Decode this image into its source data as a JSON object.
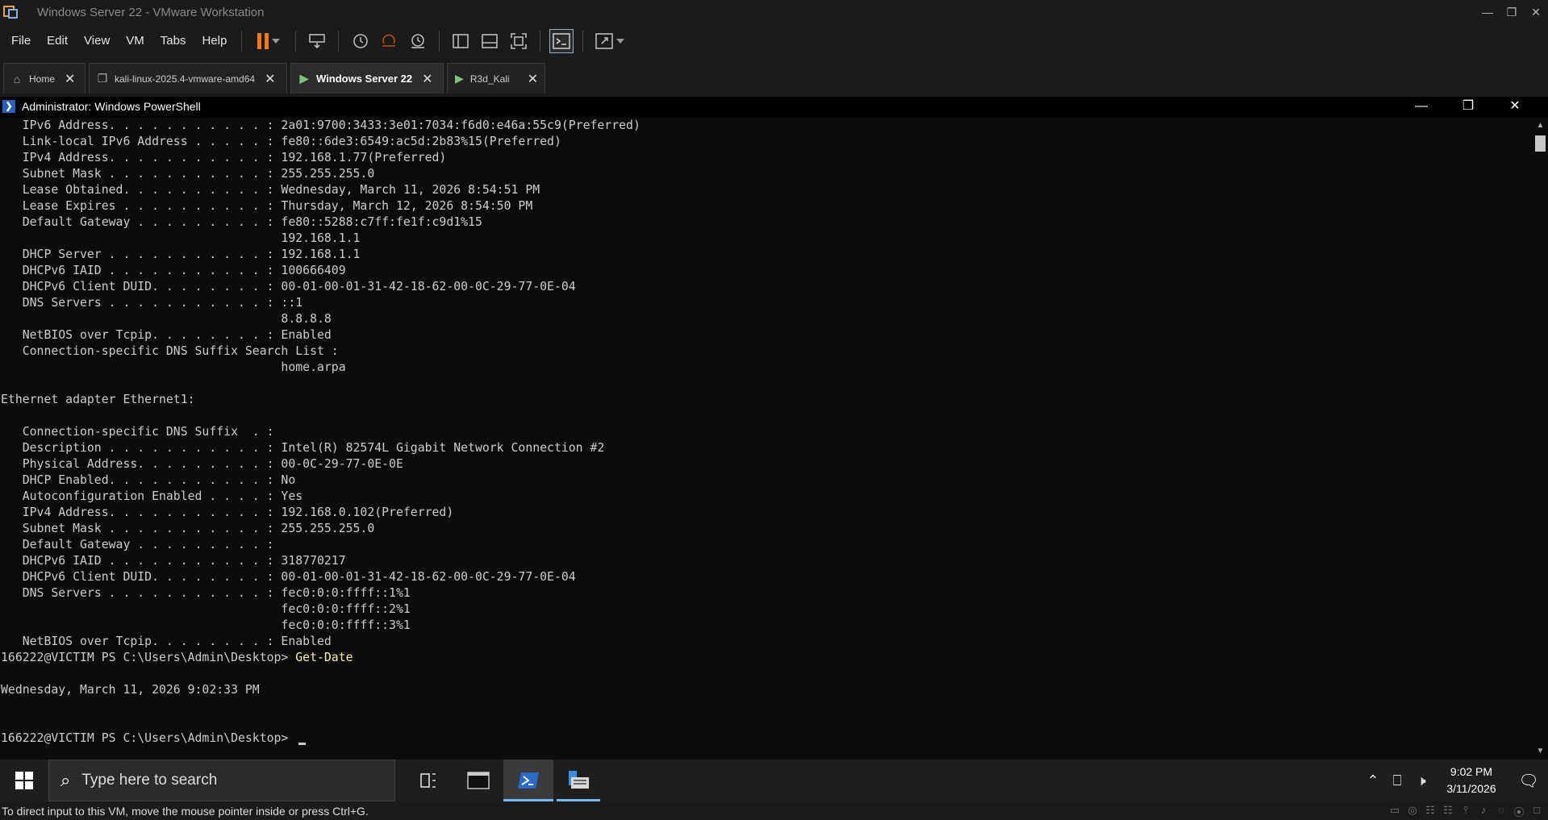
{
  "window": {
    "title": "Windows Server 22 - VMware Workstation"
  },
  "menu": [
    "File",
    "Edit",
    "View",
    "VM",
    "Tabs",
    "Help"
  ],
  "tabs": [
    {
      "label": "Home",
      "icon": "home-icon",
      "active": false
    },
    {
      "label": "kali-linux-2025.4-vmware-amd64",
      "icon": "vm-icon",
      "active": false
    },
    {
      "label": "Windows Server 22",
      "icon": "vm-running-icon",
      "active": true
    },
    {
      "label": "R3d_Kali",
      "icon": "vm-running-icon",
      "active": false
    }
  ],
  "powershell": {
    "title": "Administrator: Windows PowerShell",
    "lines": [
      {
        "text": "   IPv6 Address. . . . . . . . . . . : 2a01:9700:3433:3e01:7034:f6d0:e46a:55c9(Preferred)"
      },
      {
        "text": "   Link-local IPv6 Address . . . . . : fe80::6de3:6549:ac5d:2b83%15(Preferred)"
      },
      {
        "text": "   IPv4 Address. . . . . . . . . . . : 192.168.1.77(Preferred)"
      },
      {
        "text": "   Subnet Mask . . . . . . . . . . . : 255.255.255.0"
      },
      {
        "text": "   Lease Obtained. . . . . . . . . . : Wednesday, March 11, 2026 8:54:51 PM"
      },
      {
        "text": "   Lease Expires . . . . . . . . . . : Thursday, March 12, 2026 8:54:50 PM"
      },
      {
        "text": "   Default Gateway . . . . . . . . . : fe80::5288:c7ff:fe1f:c9d1%15"
      },
      {
        "text": "                                       192.168.1.1"
      },
      {
        "text": "   DHCP Server . . . . . . . . . . . : 192.168.1.1"
      },
      {
        "text": "   DHCPv6 IAID . . . . . . . . . . . : 100666409"
      },
      {
        "text": "   DHCPv6 Client DUID. . . . . . . . : 00-01-00-01-31-42-18-62-00-0C-29-77-0E-04"
      },
      {
        "text": "   DNS Servers . . . . . . . . . . . : ::1"
      },
      {
        "text": "                                       8.8.8.8"
      },
      {
        "text": "   NetBIOS over Tcpip. . . . . . . . : Enabled"
      },
      {
        "text": "   Connection-specific DNS Suffix Search List :"
      },
      {
        "text": "                                       home.arpa"
      },
      {
        "text": ""
      },
      {
        "text": "Ethernet adapter Ethernet1:"
      },
      {
        "text": ""
      },
      {
        "text": "   Connection-specific DNS Suffix  . :"
      },
      {
        "text": "   Description . . . . . . . . . . . : Intel(R) 82574L Gigabit Network Connection #2"
      },
      {
        "text": "   Physical Address. . . . . . . . . : 00-0C-29-77-0E-0E"
      },
      {
        "text": "   DHCP Enabled. . . . . . . . . . . : No"
      },
      {
        "text": "   Autoconfiguration Enabled . . . . : Yes"
      },
      {
        "text": "   IPv4 Address. . . . . . . . . . . : 192.168.0.102(Preferred)"
      },
      {
        "text": "   Subnet Mask . . . . . . . . . . . : 255.255.255.0"
      },
      {
        "text": "   Default Gateway . . . . . . . . . :"
      },
      {
        "text": "   DHCPv6 IAID . . . . . . . . . . . : 318770217"
      },
      {
        "text": "   DHCPv6 Client DUID. . . . . . . . : 00-01-00-01-31-42-18-62-00-0C-29-77-0E-04"
      },
      {
        "text": "   DNS Servers . . . . . . . . . . . : fec0:0:0:ffff::1%1"
      },
      {
        "text": "                                       fec0:0:0:ffff::2%1"
      },
      {
        "text": "                                       fec0:0:0:ffff::3%1"
      },
      {
        "text": "   NetBIOS over Tcpip. . . . . . . . : Enabled"
      },
      {
        "text": "166222@VICTIM PS C:\\Users\\Admin\\Desktop> ",
        "cmd": "Get-Date"
      },
      {
        "text": ""
      },
      {
        "text": "Wednesday, March 11, 2026 9:02:33 PM"
      },
      {
        "text": ""
      },
      {
        "text": ""
      },
      {
        "text": "166222@VICTIM PS C:\\Users\\Admin\\Desktop> ",
        "cursor": true
      }
    ]
  },
  "taskbar": {
    "search_placeholder": "Type here to search",
    "time": "9:02 PM",
    "date": "3/11/2026"
  },
  "status": {
    "text": "To direct input to this VM, move the mouse pointer inside or press Ctrl+G."
  },
  "colors": {
    "accent_orange": "#f07a1a",
    "taskbar_accent": "#76b9ed",
    "console_bg": "#0c0c0c",
    "command_yellow": "#f9f1a5"
  }
}
